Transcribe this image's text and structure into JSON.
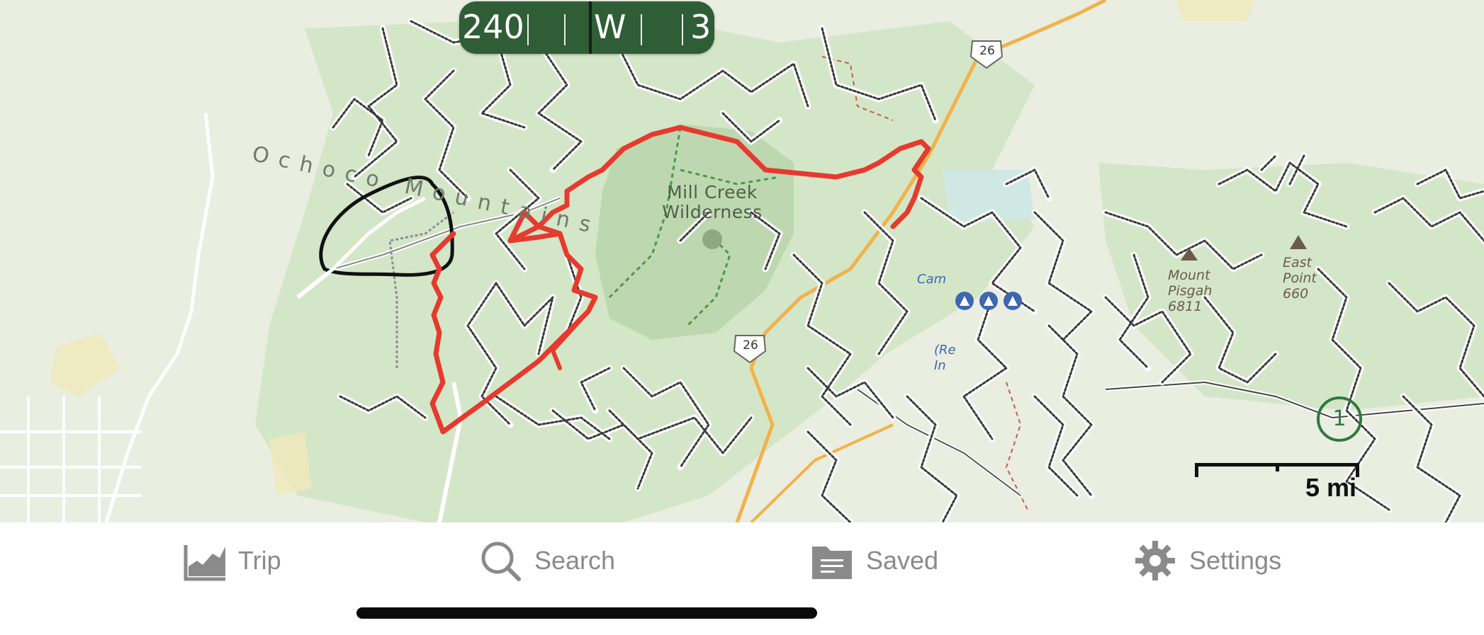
{
  "compass": {
    "left_value": "240",
    "direction": "W",
    "right_value": "3"
  },
  "map": {
    "range_label": "Ochoco Mountains",
    "wilderness_label_line1": "Mill Creek",
    "wilderness_label_line2": "Wilderness",
    "highway_shield_1": "26",
    "highway_shield_2": "26",
    "peak1_line1": "Mount",
    "peak1_line2": "Pisgah",
    "peak1_line3": "6811",
    "peak2_line1": "East",
    "peak2_line2": "Point",
    "peak2_line3": "660",
    "camp_label": "Cam",
    "reservation_line1": "(Re",
    "reservation_line2": "In",
    "circle_marker": "1",
    "scale_label": "5 mi"
  },
  "tabs": [
    {
      "label": "Trip",
      "icon": "trip-chart-icon"
    },
    {
      "label": "Search",
      "icon": "search-icon"
    },
    {
      "label": "Saved",
      "icon": "folder-icon"
    },
    {
      "label": "Settings",
      "icon": "gear-icon"
    }
  ],
  "colors": {
    "track_red": "#e63a2e",
    "compass_green": "#2f5d36",
    "forest_green": "#cfe3c3",
    "wilderness_green": "#b9d6ad"
  }
}
